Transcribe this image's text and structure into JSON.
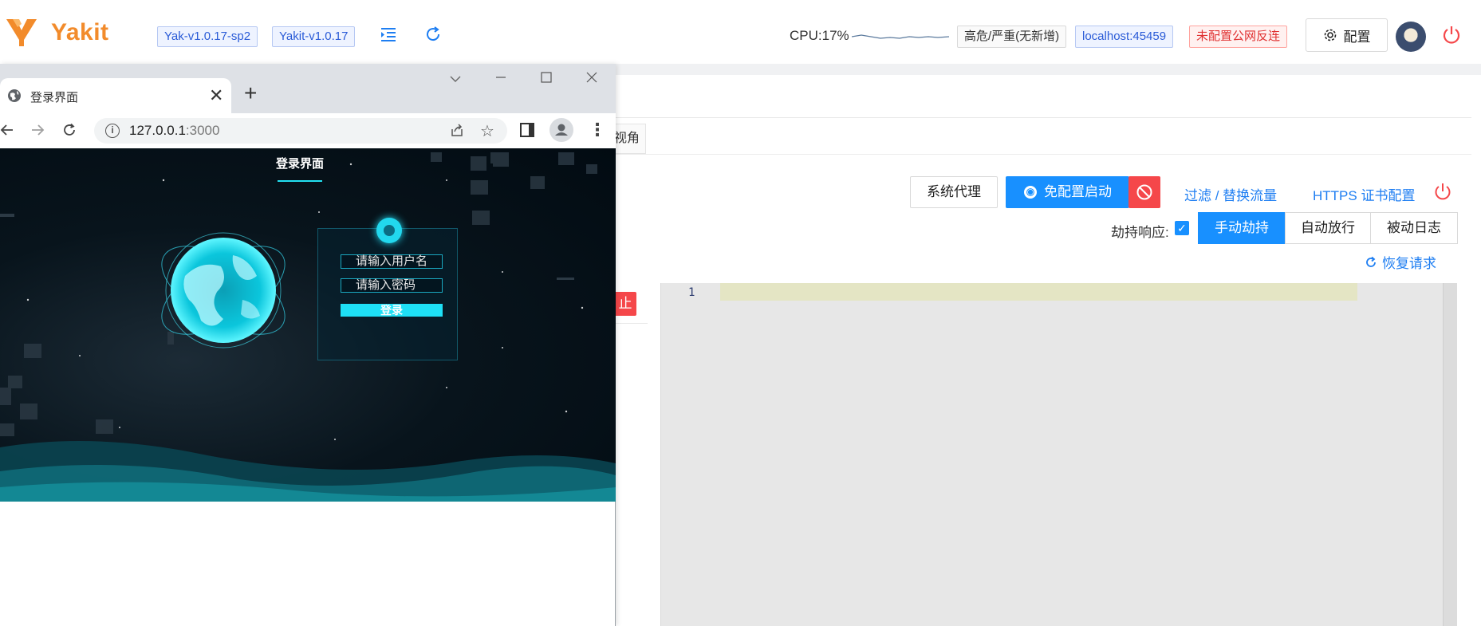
{
  "app": {
    "logo_text": "Yakit",
    "version_tags": [
      "Yak-v1.0.17-sp2",
      "Yakit-v1.0.17"
    ],
    "cpu_label": "CPU:17%",
    "risk_tag": "高危/严重(无新增)",
    "host_tag": "localhost:45459",
    "reverse_tag": "未配置公网反连",
    "config_label": "配置",
    "colors": {
      "accent": "#1890ff",
      "logo": "#f28b2b",
      "danger": "#f5474a"
    }
  },
  "mitm": {
    "view_tab_label": "视角",
    "system_proxy_label": "系统代理",
    "free_start_label": "免配置启动",
    "filter_link": "过滤 / 替换流量",
    "https_link": "HTTPS 证书配置",
    "hijack_response_label": "劫持响应:",
    "mode_tabs": [
      "手动劫持",
      "自动放行",
      "被动日志"
    ],
    "restore_label": "恢复请求",
    "stop_label": "止",
    "editor_line_number": "1"
  },
  "browser": {
    "tab_title": "登录界面",
    "url_host": "127.0.0.1",
    "url_port": ":3000",
    "page": {
      "heading": "登录界面",
      "username_placeholder": "请输入用户名",
      "password_placeholder": "请输入密码",
      "login_button": "登录"
    }
  }
}
